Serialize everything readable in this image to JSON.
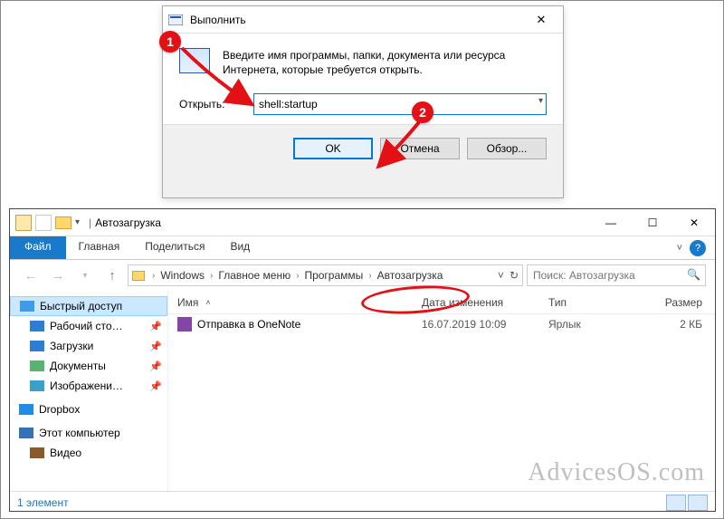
{
  "run": {
    "title": "Выполнить",
    "description": "Введите имя программы, папки, документа или ресурса Интернета, которые требуется открыть.",
    "open_label": "Открыть:",
    "input_value": "shell:startup",
    "ok": "OK",
    "cancel": "Отмена",
    "browse": "Обзор..."
  },
  "badges": {
    "b1": "1",
    "b2": "2"
  },
  "explorer": {
    "window_title": "Автозагрузка",
    "tabs": {
      "file": "Файл",
      "home": "Главная",
      "share": "Поделиться",
      "view": "Вид"
    },
    "breadcrumb": [
      "Windows",
      "Главное меню",
      "Программы",
      "Автозагрузка"
    ],
    "search_placeholder": "Поиск: Автозагрузка",
    "columns": {
      "name": "Имя",
      "date": "Дата изменения",
      "type": "Тип",
      "size": "Размер"
    },
    "rows": [
      {
        "name": "Отправка в OneNote",
        "date": "16.07.2019 10:09",
        "type": "Ярлык",
        "size": "2 КБ"
      }
    ],
    "sidebar": {
      "quick": "Быстрый доступ",
      "desktop": "Рабочий сто…",
      "downloads": "Загрузки",
      "documents": "Документы",
      "pictures": "Изображени…",
      "dropbox": "Dropbox",
      "thispc": "Этот компьютер",
      "videos": "Видео"
    },
    "status": "1 элемент"
  },
  "watermark": "AdvicesOS.com"
}
